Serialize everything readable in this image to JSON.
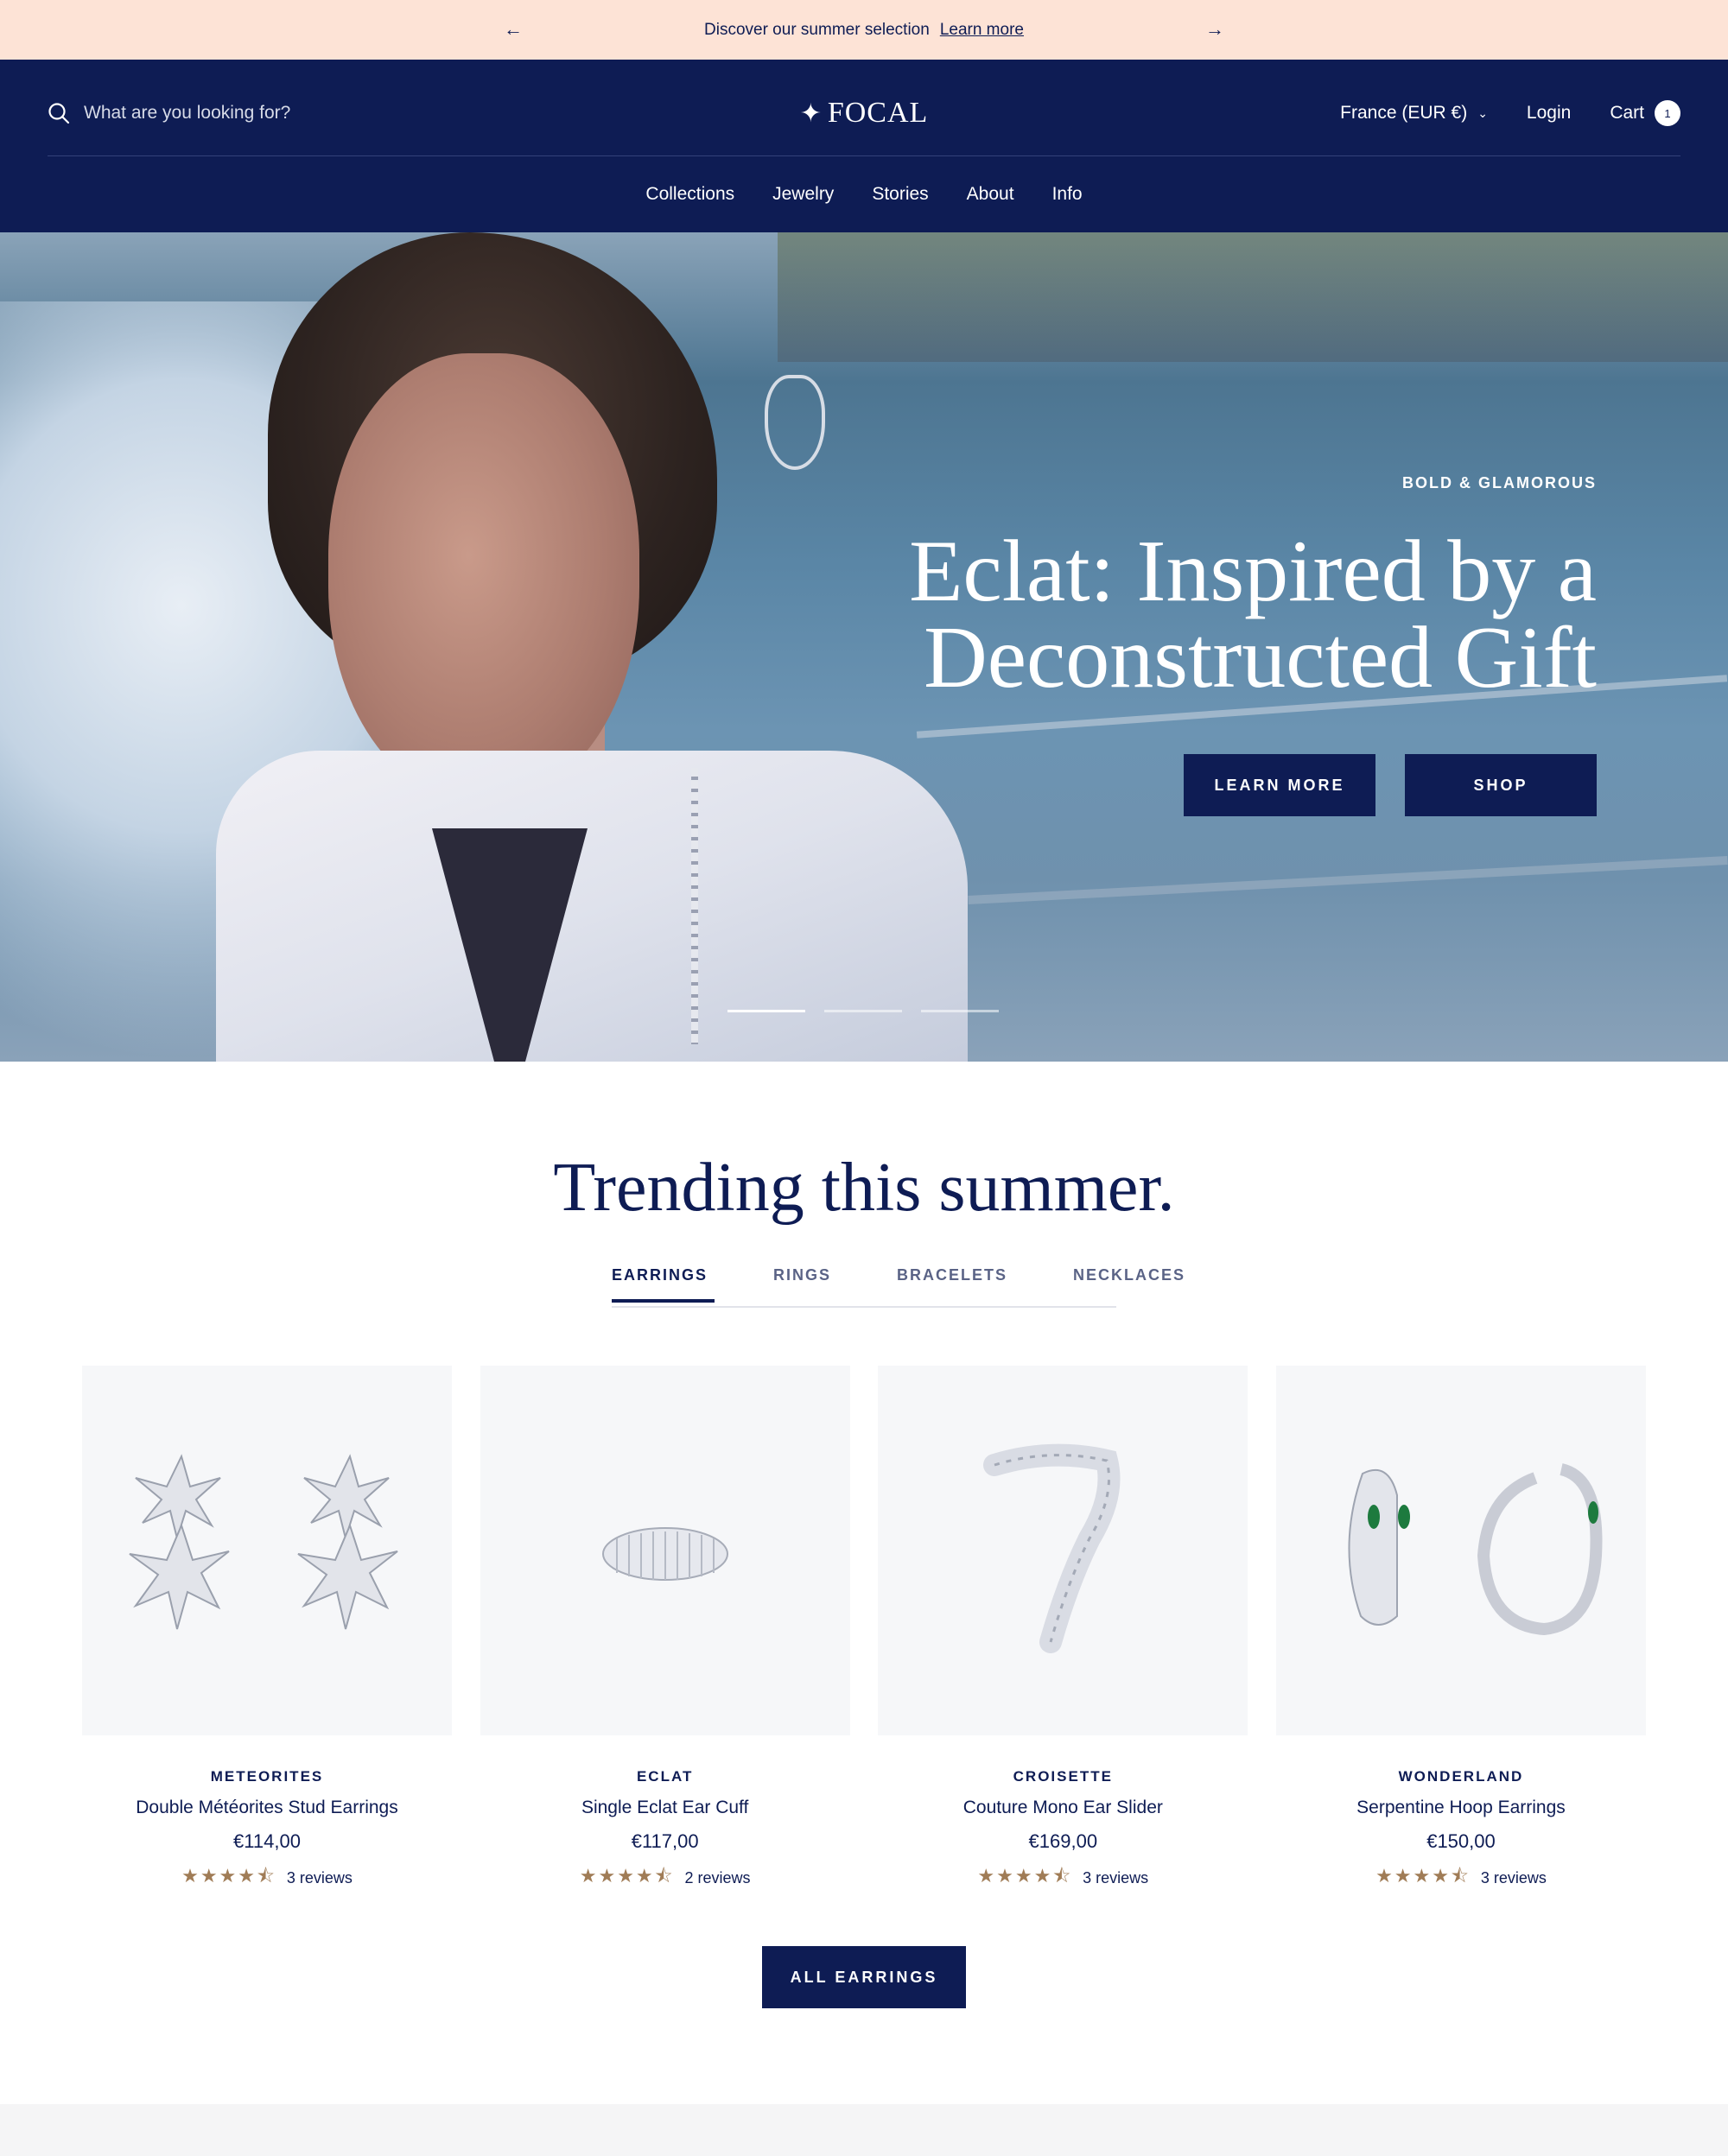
{
  "announcement": {
    "text": "Discover our summer selection",
    "link": "Learn more",
    "prev_icon": "arrow-left-icon",
    "next_icon": "arrow-right-icon",
    "prev_glyph": "←",
    "next_glyph": "→"
  },
  "header": {
    "search_placeholder": "What are you looking for?",
    "logo_star": "✦",
    "logo": "FOCAL",
    "country": "France (EUR €)",
    "chevron": "⌄",
    "login": "Login",
    "cart": "Cart",
    "cart_count": "1"
  },
  "nav": [
    "Collections",
    "Jewelry",
    "Stories",
    "About",
    "Info"
  ],
  "hero": {
    "eyebrow": "BOLD & GLAMOROUS",
    "headline_line1": "Eclat: Inspired by a",
    "headline_line2": "Deconstructed Gift",
    "btn_learn": "LEARN MORE",
    "btn_shop": "SHOP",
    "slide_count": 3,
    "active_slide": 1
  },
  "trending": {
    "title": "Trending this summer.",
    "tabs": [
      "EARRINGS",
      "RINGS",
      "BRACELETS",
      "NECKLACES"
    ],
    "active_tab": "EARRINGS",
    "products": [
      {
        "brand": "METEORITES",
        "name": "Double Météorites Stud Earrings",
        "price": "€114,00",
        "stars": "★★★★⯪",
        "rating": 4.5,
        "reviews": "3 reviews"
      },
      {
        "brand": "ECLAT",
        "name": "Single Eclat Ear Cuff",
        "price": "€117,00",
        "stars": "★★★★⯪",
        "rating": 4.5,
        "reviews": "2 reviews"
      },
      {
        "brand": "CROISETTE",
        "name": "Couture Mono Ear Slider",
        "price": "€169,00",
        "stars": "★★★★⯪",
        "rating": 4.5,
        "reviews": "3 reviews"
      },
      {
        "brand": "WONDERLAND",
        "name": "Serpentine Hoop Earrings",
        "price": "€150,00",
        "stars": "★★★★⯪",
        "rating": 4.5,
        "reviews": "3 reviews"
      }
    ],
    "cta": "ALL EARRINGS"
  },
  "colors": {
    "navy": "#0e1c54",
    "announce_bg": "#fde3d6",
    "star": "#a07c56",
    "product_bg": "#f6f7f9"
  }
}
